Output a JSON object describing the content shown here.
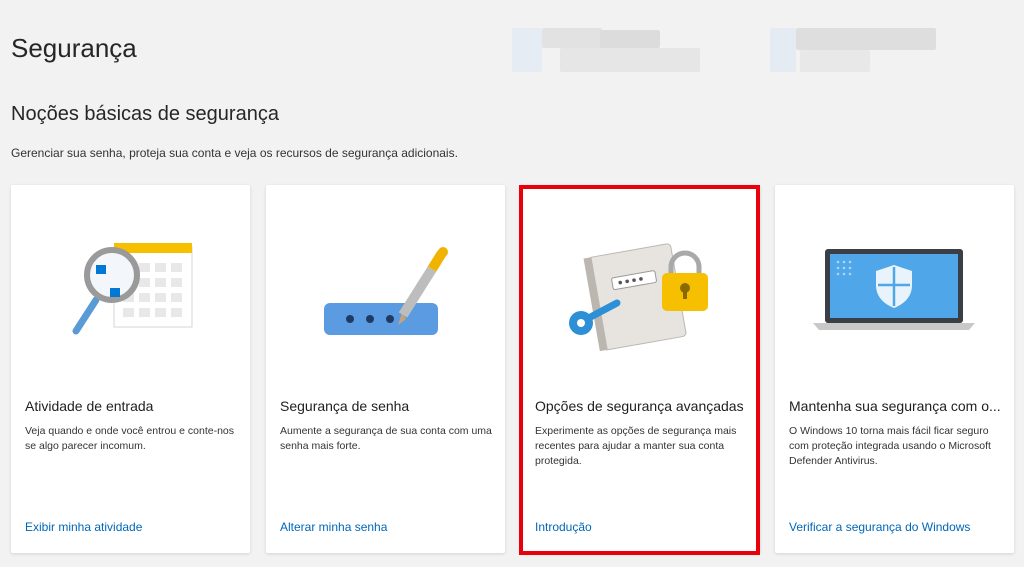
{
  "header": {
    "title": "Segurança"
  },
  "basics": {
    "title": "Noções básicas de segurança",
    "description": "Gerenciar sua senha, proteja sua conta e veja os recursos de segurança adicionais."
  },
  "cards": [
    {
      "title": "Atividade de entrada",
      "description": "Veja quando e onde você entrou e conte-nos se algo parecer incomum.",
      "link": "Exibir minha atividade",
      "icon": "magnifier-calendar-icon"
    },
    {
      "title": "Segurança de senha",
      "description": "Aumente a segurança de sua conta com uma senha mais forte.",
      "link": "Alterar minha senha",
      "icon": "password-pen-icon"
    },
    {
      "title": "Opções de segurança avançadas",
      "description": "Experimente as opções de segurança mais recentes para ajudar a manter sua conta protegida.",
      "link": "Introdução",
      "icon": "notebook-key-lock-icon"
    },
    {
      "title": "Mantenha sua segurança com o...",
      "description": "O Windows 10 torna mais fácil ficar seguro com proteção integrada usando o Microsoft Defender Antivirus.",
      "link": "Verificar a segurança do Windows",
      "icon": "laptop-shield-icon"
    }
  ],
  "colors": {
    "link": "#0067b8",
    "highlight": "#e8000b",
    "background": "#f2f2f2"
  }
}
